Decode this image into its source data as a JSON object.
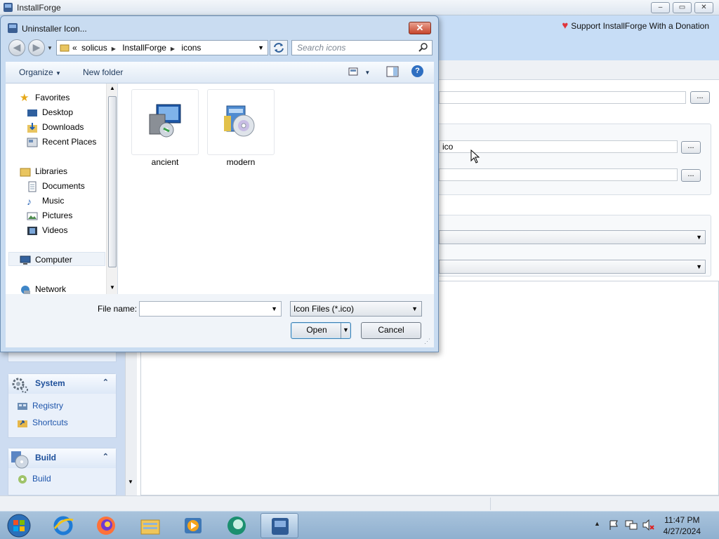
{
  "app": {
    "title": "InstallForge",
    "window_buttons": {
      "minimize": "–",
      "maximize": "▭",
      "close": "✕"
    },
    "donation_link": "Support InstallForge With a Donation",
    "fields": {
      "uninstaller_icon_value": "ico"
    },
    "dots": "..."
  },
  "sidebar": {
    "groups": [
      {
        "title": "System",
        "collapse": "⌃",
        "items": [
          "Registry",
          "Shortcuts"
        ]
      },
      {
        "title": "Build",
        "collapse": "⌃",
        "items": [
          "Build"
        ]
      }
    ]
  },
  "dialog": {
    "title": "Uninstaller Icon...",
    "close": "✕",
    "address": {
      "prefix": "«",
      "segments": [
        "solicus",
        "InstallForge",
        "icons"
      ]
    },
    "search_placeholder": "Search icons",
    "toolbar": {
      "organize": "Organize",
      "new_folder": "New folder",
      "help": "?"
    },
    "nav": {
      "favorites": "Favorites",
      "favorites_items": [
        "Desktop",
        "Downloads",
        "Recent Places"
      ],
      "libraries": "Libraries",
      "libraries_items": [
        "Documents",
        "Music",
        "Pictures",
        "Videos"
      ],
      "computer": "Computer",
      "network": "Network"
    },
    "files": [
      {
        "name": "ancient",
        "icon": "installer-package-icon"
      },
      {
        "name": "modern",
        "icon": "installer-disc-icon"
      }
    ],
    "file_name_label": "File name:",
    "file_name_value": "",
    "file_type": "Icon Files (*.ico)",
    "open_label": "Open",
    "cancel_label": "Cancel"
  },
  "taskbar": {
    "apps": [
      "start-orb-icon",
      "internet-explorer-icon",
      "firefox-icon",
      "file-explorer-icon",
      "media-player-icon",
      "browser-app-icon",
      "installforge-icon"
    ],
    "clock_time": "11:47 PM",
    "clock_date": "4/27/2024"
  },
  "colors": {
    "accent": "#1e55ab",
    "banner": "#c7ddf6",
    "dialog_frame": "#c9dcf1"
  }
}
